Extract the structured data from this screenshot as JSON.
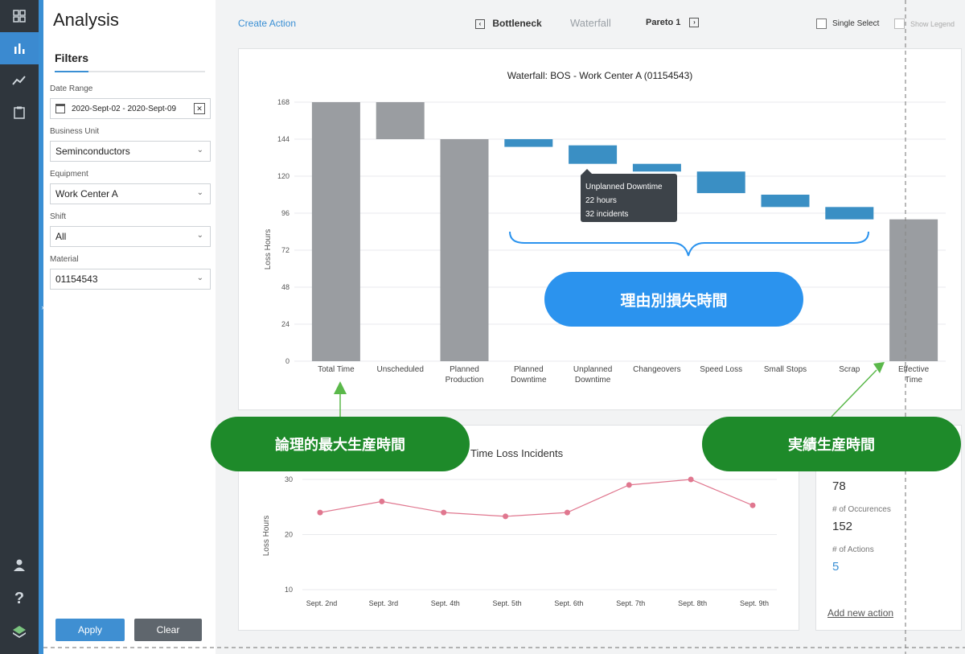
{
  "rail": {
    "icons": [
      "dashboard-icon",
      "bar-chart-icon",
      "trend-icon",
      "clipboard-icon",
      "user-icon",
      "help-icon",
      "layers-icon"
    ]
  },
  "panel": {
    "title": "Analysis",
    "tab": "Filters",
    "filters": [
      {
        "label": "Date Range",
        "value": "2020-Sept-02 - 2020-Sept-09"
      },
      {
        "label": "Business Unit",
        "value": "Seminconductors"
      },
      {
        "label": "Equipment",
        "value": "Work Center A"
      },
      {
        "label": "Shift",
        "value": "All"
      },
      {
        "label": "Material",
        "value": "01154543"
      }
    ],
    "apply": "Apply",
    "clear": "Clear"
  },
  "toolbar": {
    "create_action": "Create Action",
    "views": [
      "Bottleneck",
      "Waterfall",
      "Pareto 1"
    ],
    "single_select": "Single Select",
    "show_legend": "Show Legend"
  },
  "colors": {
    "gray_bar": "#9a9da1",
    "blue_bar": "#3a8fc4",
    "line": "#e0778f",
    "accent": "#3a8fd4",
    "callout_blue": "#2b93ee",
    "callout_green": "#1e8a2a"
  },
  "waterfall": {
    "tooltip": [
      "Unplanned Downtime",
      "22 hours",
      "32 incidents"
    ]
  },
  "stats": {
    "items": [
      {
        "label": "",
        "value": "78"
      },
      {
        "label": "# of Occurences",
        "value": "152"
      },
      {
        "label": "# of Actions",
        "value": "5"
      }
    ],
    "add_action": "Add new action"
  },
  "callouts": {
    "blue": "理由別損失時間",
    "green_left": "論理的最大生産時間",
    "green_right": "実績生産時間"
  },
  "chart_data": [
    {
      "type": "bar",
      "title": "Waterfall: BOS - Work Center A (01154543)",
      "ylabel": "Loss Hours",
      "ylim": [
        0,
        168
      ],
      "yticks": [
        0,
        24,
        48,
        72,
        96,
        120,
        144,
        168
      ],
      "categories": [
        "Total Time",
        "Unscheduled",
        "Planned Production",
        "Planned Downtime",
        "Unplanned Downtime",
        "Changeovers",
        "Speed Loss",
        "Small Stops",
        "Scrap",
        "Effective Time"
      ],
      "bars": [
        {
          "start": 0,
          "end": 168,
          "kind": "total"
        },
        {
          "start": 144,
          "end": 168,
          "kind": "total"
        },
        {
          "start": 0,
          "end": 144,
          "kind": "total"
        },
        {
          "start": 139,
          "end": 144,
          "kind": "loss"
        },
        {
          "start": 128,
          "end": 140,
          "kind": "loss"
        },
        {
          "start": 123,
          "end": 128,
          "kind": "loss"
        },
        {
          "start": 109,
          "end": 123,
          "kind": "loss"
        },
        {
          "start": 100,
          "end": 108,
          "kind": "loss"
        },
        {
          "start": 92,
          "end": 100,
          "kind": "loss"
        },
        {
          "start": 0,
          "end": 92,
          "kind": "total"
        }
      ]
    },
    {
      "type": "line",
      "title": "Time Loss Incidents",
      "ylabel": "Loss Hours",
      "ylim": [
        10,
        30
      ],
      "yticks": [
        10,
        20,
        30
      ],
      "categories": [
        "Sept. 2nd",
        "Sept. 3rd",
        "Sept. 4th",
        "Sept. 5th",
        "Sept. 6th",
        "Sept. 7th",
        "Sept. 8th",
        "Sept. 9th"
      ],
      "values": [
        24,
        26,
        24,
        23.3,
        24,
        29,
        30,
        25.3
      ]
    }
  ]
}
